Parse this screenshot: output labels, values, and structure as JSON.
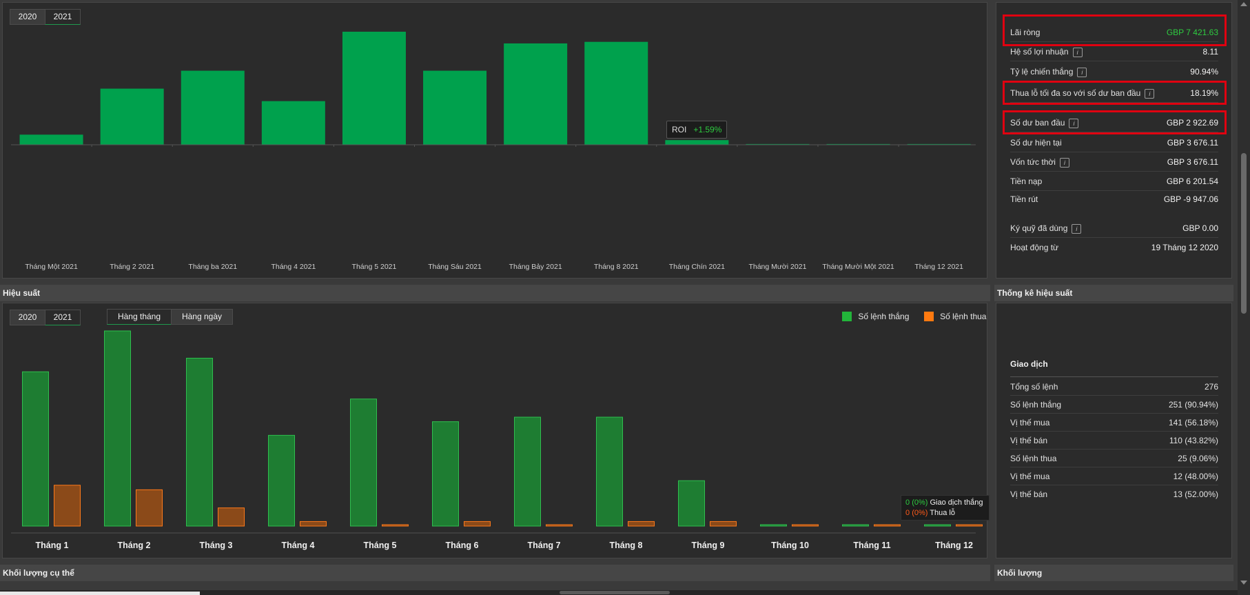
{
  "roi_section": {
    "years": [
      "2020",
      "2021"
    ],
    "active_year": "2021",
    "tooltip": {
      "label": "ROI",
      "value": "+1.59%"
    }
  },
  "summary": {
    "net_profit": {
      "label": "Lãi ròng",
      "value": "GBP 7 421.63"
    },
    "profit_factor": {
      "label": "Hệ số lợi nhuận",
      "value": "8.11"
    },
    "win_rate": {
      "label": "Tỷ lệ chiến thắng",
      "value": "90.94%"
    },
    "max_drawdown": {
      "label": "Thua lỗ tối đa so với số dư ban đầu",
      "value": "18.19%"
    },
    "initial_balance": {
      "label": "Số dư ban đầu",
      "value": "GBP 2 922.69"
    },
    "current_balance": {
      "label": "Số dư hiện tại",
      "value": "GBP 3 676.11"
    },
    "equity": {
      "label": "Vốn tức thời",
      "value": "GBP 3 676.11"
    },
    "deposits": {
      "label": "Tiền nạp",
      "value": "GBP 6 201.54"
    },
    "withdrawals": {
      "label": "Tiền rút",
      "value": "GBP -9 947.06"
    },
    "margin_used": {
      "label": "Ký quỹ đã dùng",
      "value": "GBP 0.00"
    },
    "active_since": {
      "label": "Hoạt động từ",
      "value": "19 Tháng 12 2020"
    }
  },
  "performance": {
    "title": "Hiệu suất",
    "years": [
      "2020",
      "2021"
    ],
    "active_year": "2021",
    "modes": [
      "Hàng tháng",
      "Hàng ngày"
    ],
    "active_mode": "Hàng tháng",
    "legend": {
      "wins": "Số lệnh thắng",
      "losses": "Số lệnh thua"
    },
    "tooltip": {
      "win_count": "0",
      "win_pct": "(0%)",
      "win_label": "Giao dịch thắng",
      "loss_count": "0",
      "loss_pct": "(0%)",
      "loss_label": "Thua lỗ"
    }
  },
  "perf_stats": {
    "title": "Thống kê hiệu suất",
    "section": "Giao dịch",
    "rows": [
      {
        "label": "Tổng số lệnh",
        "value": "276"
      },
      {
        "label": "Số lệnh thắng",
        "value": "251 (90.94%)"
      },
      {
        "label": "Vị thế mua",
        "value": "141 (56.18%)"
      },
      {
        "label": "Vị thế bán",
        "value": "110 (43.82%)"
      },
      {
        "label": "Số lệnh thua",
        "value": "25 (9.06%)"
      },
      {
        "label": "Vị thế mua",
        "value": "12 (48.00%)"
      },
      {
        "label": "Vị thế bán",
        "value": "13 (52.00%)"
      }
    ]
  },
  "footer": {
    "volume_left": "Khối lượng cụ thể",
    "volume_right": "Khối lượng"
  },
  "colors": {
    "roi_bar": "#00a14d",
    "win_bar": "#1e7d32",
    "win_stroke": "#2fbf4f",
    "loss_bar": "#8b4a19",
    "loss_stroke": "#ff7a1a",
    "legend_win": "#22b53a",
    "legend_loss": "#ff7a10",
    "positive_text": "#2ecc40",
    "negative_text": "#ff5a1a",
    "highlight_box": "#e00010"
  },
  "chart_data": [
    {
      "type": "bar",
      "categories": [
        "Tháng Một 2021",
        "Tháng 2 2021",
        "Tháng ba 2021",
        "Tháng 4 2021",
        "Tháng 5 2021",
        "Tháng Sáu 2021",
        "Tháng Bảy 2021",
        "Tháng 8 2021",
        "Tháng Chín 2021",
        "Tháng Mười 2021",
        "Tháng Mười Một 2021",
        "Tháng 12 2021"
      ],
      "series": [
        {
          "values": [
            1.3,
            7.2,
            9.5,
            5.6,
            14.5,
            9.5,
            13.0,
            13.2,
            0.6,
            0.1,
            0.1,
            0.1
          ]
        }
      ],
      "annotations": [
        {
          "category": "Tháng Chín 2021",
          "text": "ROI +1.59%"
        }
      ],
      "grid": false
    },
    {
      "type": "bar",
      "categories": [
        "Tháng 1",
        "Tháng 2",
        "Tháng 3",
        "Tháng 4",
        "Tháng 5",
        "Tháng 6",
        "Tháng 7",
        "Tháng 8",
        "Tháng 9",
        "Tháng 10",
        "Tháng 11",
        "Tháng 12"
      ],
      "series": [
        {
          "name": "Số lệnh thắng",
          "values": [
            34,
            43,
            37,
            20,
            28,
            23,
            24,
            24,
            10,
            0,
            0,
            0
          ]
        },
        {
          "name": "Số lệnh thua",
          "values": [
            9,
            8,
            4,
            1,
            0,
            1,
            0,
            1,
            1,
            0,
            0,
            0
          ]
        }
      ],
      "ylim": [
        0,
        43
      ],
      "legend": "top-right",
      "grid": false
    }
  ]
}
